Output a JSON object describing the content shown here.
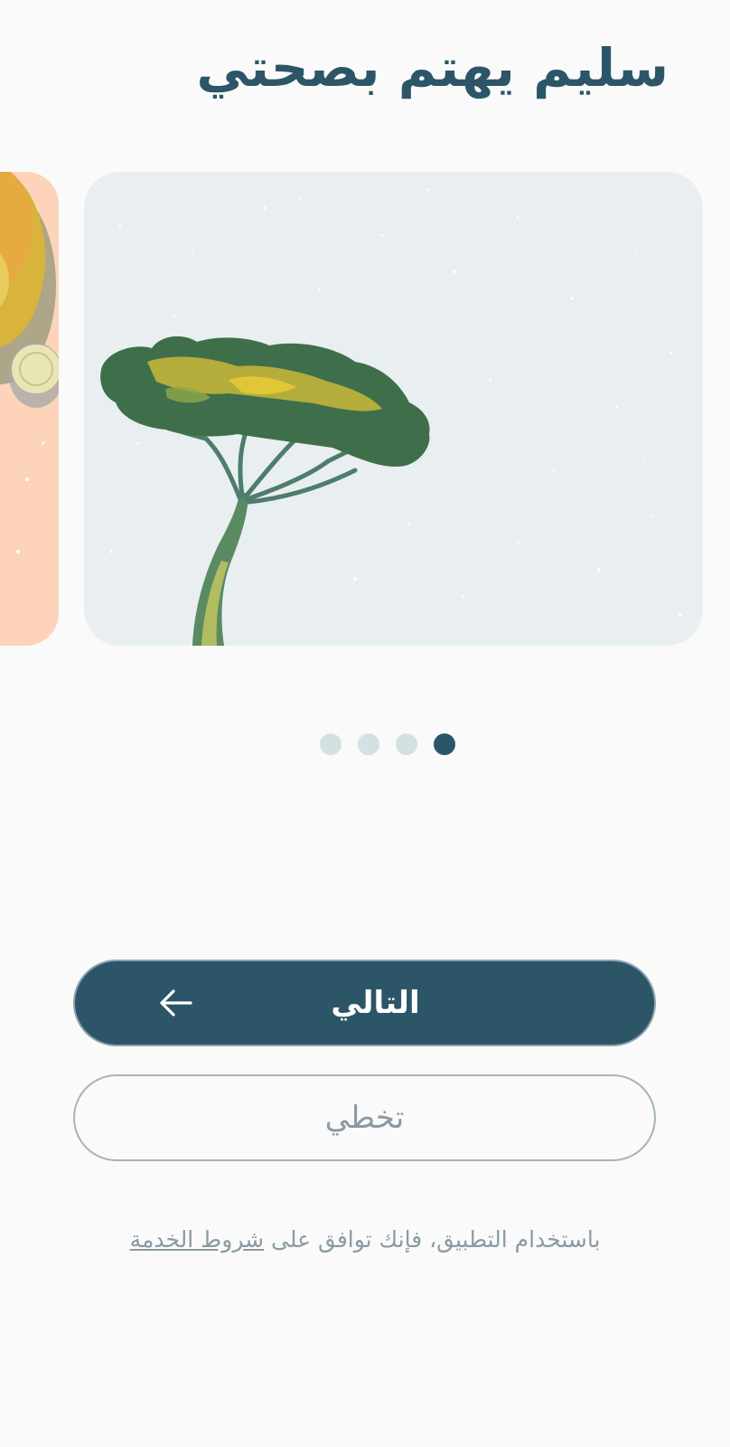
{
  "header": {
    "title": "سليم يهتم بصحتي"
  },
  "carousel": {
    "slides": [
      {
        "illustration": "watercolor-fruit",
        "background": "#fdd4b9"
      },
      {
        "illustration": "watercolor-acacia-tree",
        "background": "#e9eff0"
      }
    ],
    "page_count": 4,
    "current_page": 1
  },
  "colors": {
    "primary": "#2c5668",
    "dot_inactive": "#d3e1e2",
    "muted_text": "#8a9aa3",
    "background": "#fafafa"
  },
  "actions": {
    "next_label": "التالي",
    "next_icon": "arrow-left-icon",
    "skip_label": "تخطي"
  },
  "footer": {
    "terms_prefix": "باستخدام التطبيق، فإنك توافق على ",
    "terms_link": "شروط الخدمة"
  }
}
